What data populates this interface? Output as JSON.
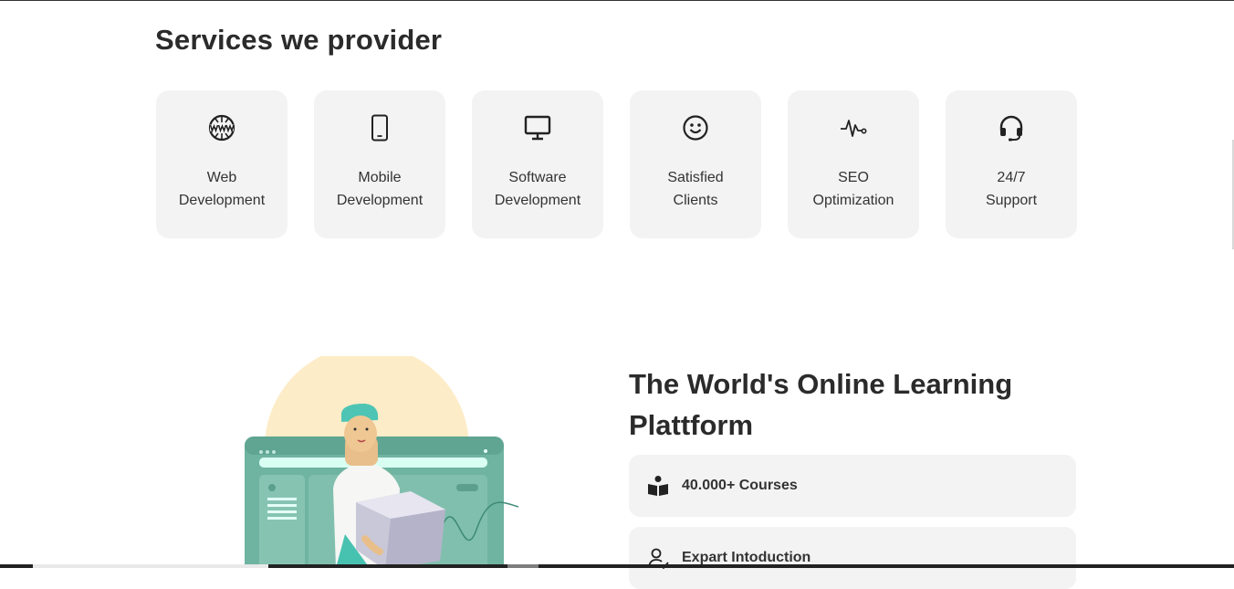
{
  "services": {
    "title": "Services we provider",
    "items": [
      {
        "icon": "www-globe-icon",
        "line1": "Web",
        "line2": "Development"
      },
      {
        "icon": "smartphone-icon",
        "line1": "Mobile",
        "line2": "Development"
      },
      {
        "icon": "monitor-icon",
        "line1": "Software",
        "line2": "Development"
      },
      {
        "icon": "smiley-face-icon",
        "line1": "Satisfied",
        "line2": "Clients"
      },
      {
        "icon": "pulse-icon",
        "line1": "SEO",
        "line2": "Optimization"
      },
      {
        "icon": "headset-icon",
        "line1": "24/7",
        "line2": "Support"
      }
    ]
  },
  "hero": {
    "title_line1": "The World's Online Learning",
    "title_line2": "Plattform",
    "features": [
      {
        "icon": "book-reader-icon",
        "text": "40.000+ Courses"
      },
      {
        "icon": "user-check-icon",
        "text": "Expart Intoduction"
      }
    ]
  },
  "colors": {
    "card_bg": "#f3f3f3",
    "text": "#2b2b2b",
    "illustration_circle": "#fdecc8",
    "illustration_screen": "#6fb4a0"
  }
}
